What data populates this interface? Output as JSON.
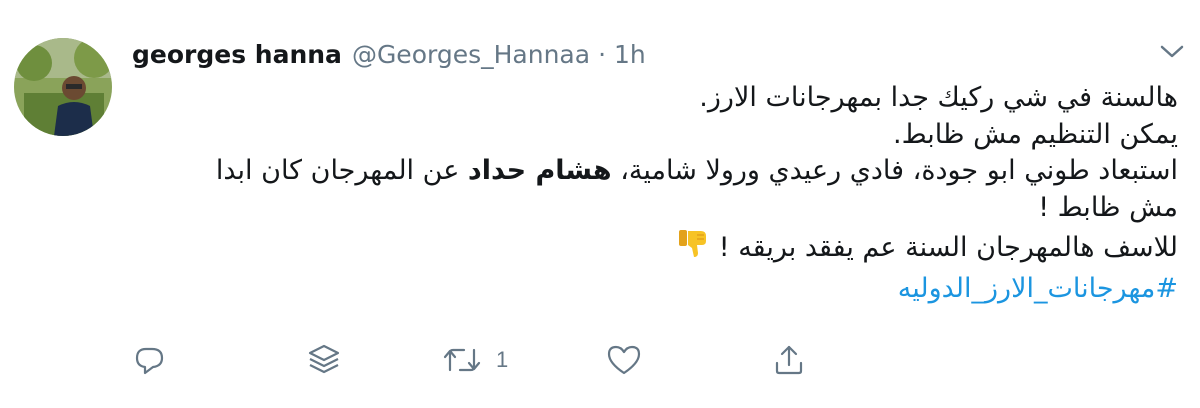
{
  "tweet": {
    "author_name": "georges hanna",
    "handle": "@Georges_Hannaa",
    "separator": "·",
    "time": "1h",
    "lines": [
      "هالسنة في شي ركيك جدا بمهرجانات الارز.",
      "يمكن التنظيم مش ظابط.",
      "المهرجان كان ابدا",
      "مش ظابط !",
      "للاسف هالمهرجان السنة عم يفقد بريقه !"
    ],
    "line3_prefix": "استبعاد طوني ابو جودة، فادي رعيدي ورولا شامية،",
    "line3_bold": "هشام حداد",
    "line3_suffix": "عن",
    "hashtag": "#مهرجانات_الارز_الدوليه",
    "emoji": "thumbs-down-emoji",
    "retweet_count": "1"
  },
  "colors": {
    "text": "#14171a",
    "secondary": "#657786",
    "link": "#1b95e0"
  },
  "icons": [
    "chevron-down-icon",
    "reply-icon",
    "stack-icon",
    "retweet-icon",
    "like-icon",
    "share-icon"
  ]
}
